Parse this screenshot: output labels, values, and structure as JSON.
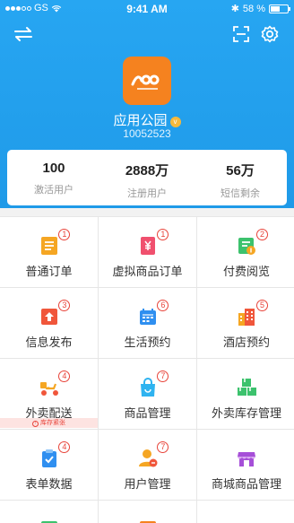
{
  "status_bar": {
    "carrier": "GS",
    "time": "9:41 AM",
    "bluetooth": "✱",
    "battery_text": "58 %",
    "battery_level": 0.58
  },
  "topbar": {
    "left_icon": "swap-arrows-icon",
    "right_icons": [
      "scan-icon",
      "settings-icon"
    ]
  },
  "app": {
    "name": "应用公园",
    "verified_mark": "v",
    "id": "10052523"
  },
  "stats": [
    {
      "value": "100",
      "label": "激活用户"
    },
    {
      "value": "2888万",
      "label": "注册用户"
    },
    {
      "value": "56万",
      "label": "短信剩余"
    }
  ],
  "colors": {
    "header": "#1f9ae8",
    "logo": "#f5821f",
    "badge": "#e8443a"
  },
  "menu": [
    {
      "label": "普通订单",
      "badge": "1",
      "icon": "order-list-icon",
      "color": "#f5a623"
    },
    {
      "label": "虚拟商品订单",
      "badge": "1",
      "icon": "yuan-list-icon",
      "color": "#f0506e"
    },
    {
      "label": "付费阅览",
      "badge": "2",
      "icon": "paid-reading-icon",
      "color": "#3cc26d"
    },
    {
      "label": "信息发布",
      "badge": "3",
      "icon": "publish-icon",
      "color": "#f0563b"
    },
    {
      "label": "生活预约",
      "badge": "6",
      "icon": "calendar-icon",
      "color": "#2f8ff0"
    },
    {
      "label": "酒店预约",
      "badge": "5",
      "icon": "hotel-icon",
      "color": "#f0563b"
    },
    {
      "label": "外卖配送",
      "badge": "4",
      "icon": "delivery-scooter-icon",
      "color": "#f5a623",
      "warning": "库存紧张"
    },
    {
      "label": "商品管理",
      "badge": "7",
      "icon": "shopping-bag-icon",
      "color": "#2fb3f0"
    },
    {
      "label": "外卖库存管理",
      "badge": "",
      "icon": "inventory-boxes-icon",
      "color": "#3cc26d"
    },
    {
      "label": "表单数据",
      "badge": "4",
      "icon": "clipboard-check-icon",
      "color": "#2f8ff0"
    },
    {
      "label": "用户管理",
      "badge": "7",
      "icon": "user-manage-icon",
      "color": "#f5a623"
    },
    {
      "label": "商城商品管理",
      "badge": "",
      "icon": "store-icon",
      "color": "#a64fd8"
    }
  ]
}
